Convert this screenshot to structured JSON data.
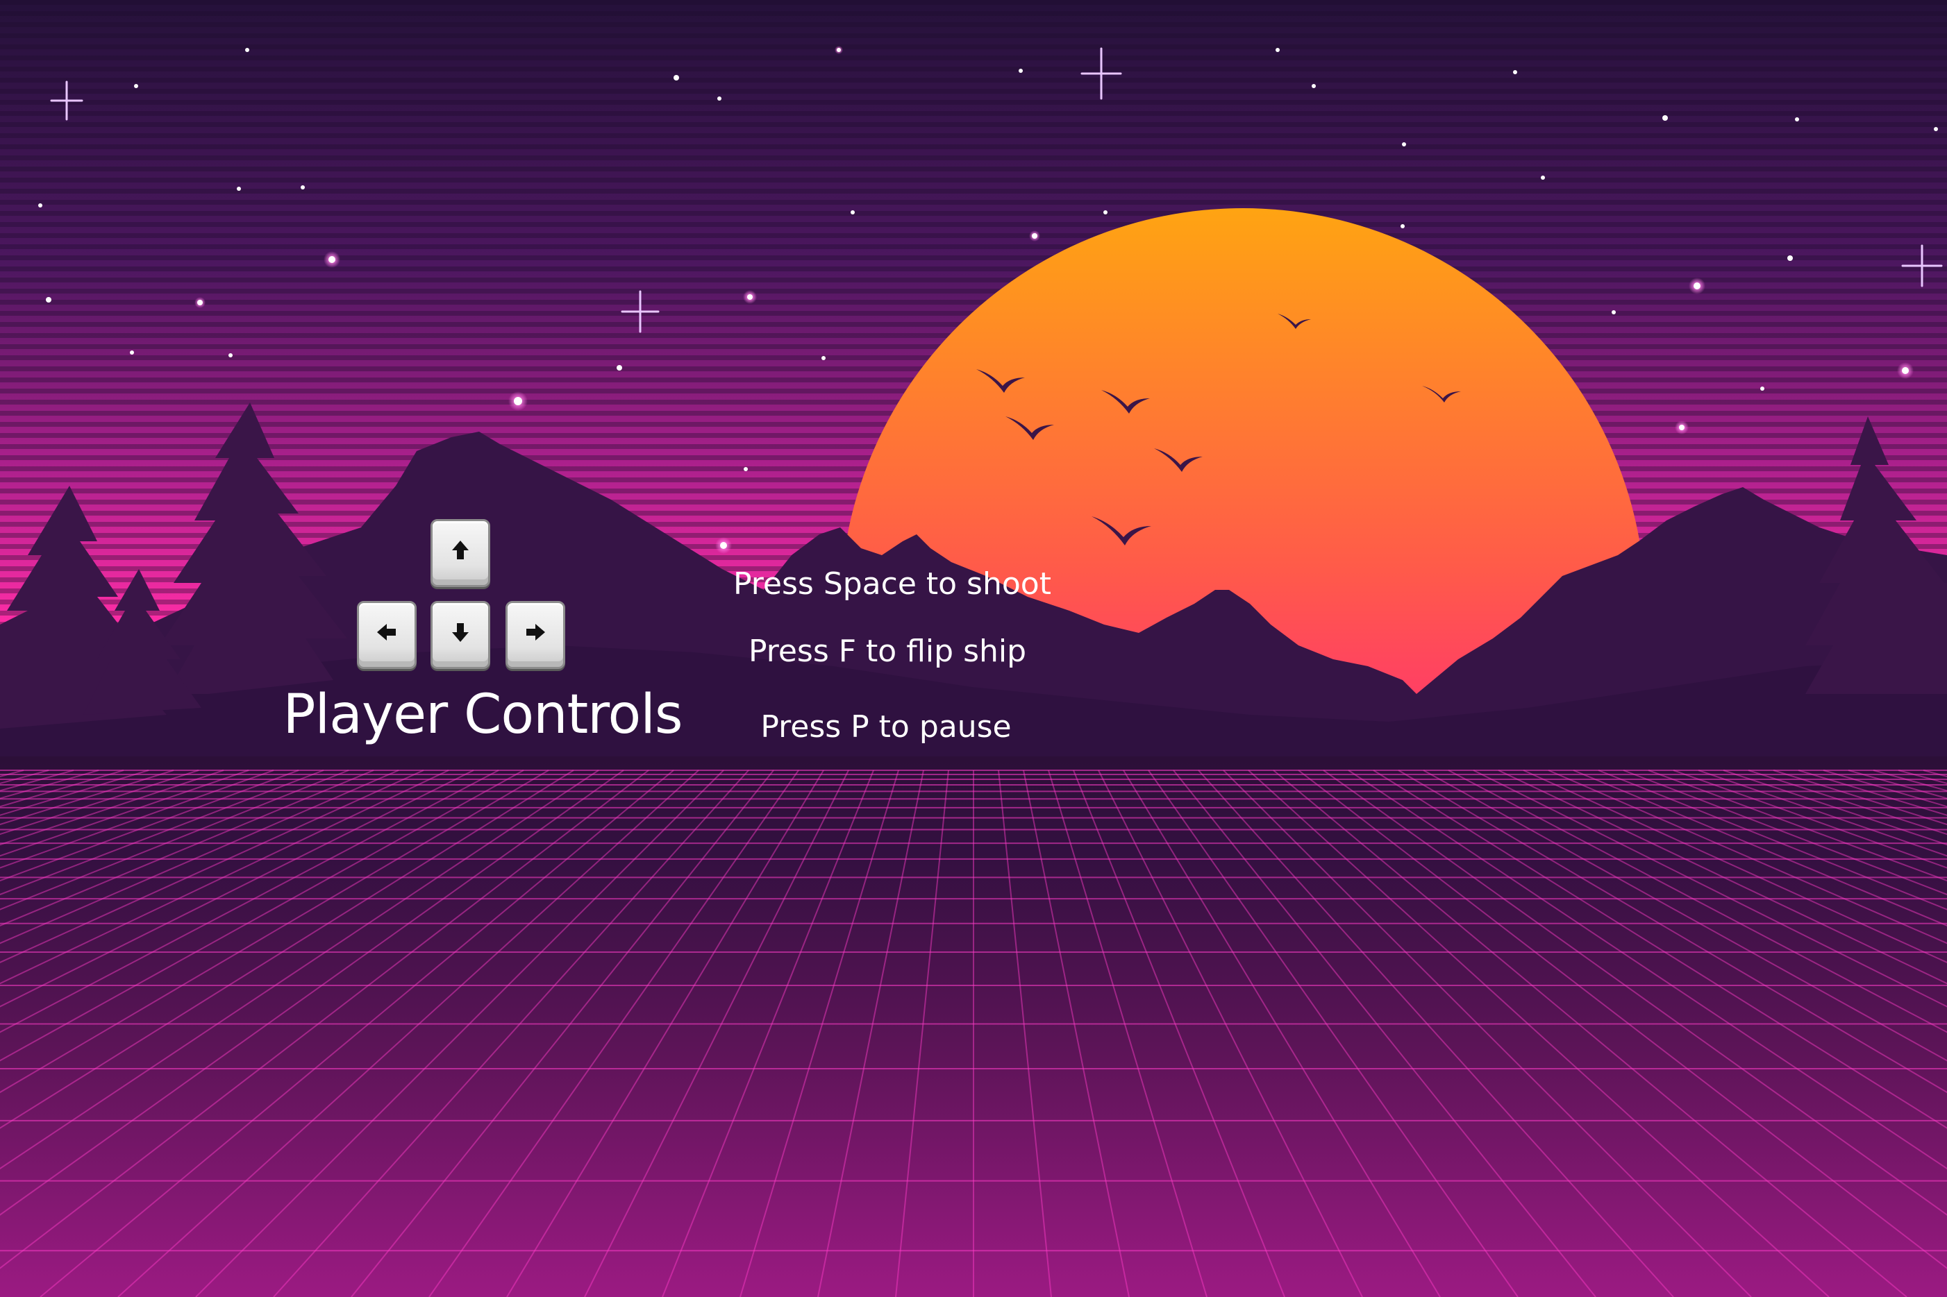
{
  "screen": "controls",
  "controls": {
    "title": "Player Controls",
    "keys": {
      "up": "arrow-up-icon",
      "left": "arrow-left-icon",
      "down": "arrow-down-icon",
      "right": "arrow-right-icon"
    },
    "hints": {
      "shoot": "Press Space to shoot",
      "flip": "Press F to flip ship",
      "pause": "Press P to pause"
    }
  },
  "colors": {
    "sky_top": "#2a1240",
    "sky_horizon": "#ff2fa8",
    "sun_top": "#ffa312",
    "sun_bottom": "#ff0a8c",
    "mountains": "#3a1548",
    "grid_line": "#ff3cc8",
    "text": "#ffffff"
  }
}
